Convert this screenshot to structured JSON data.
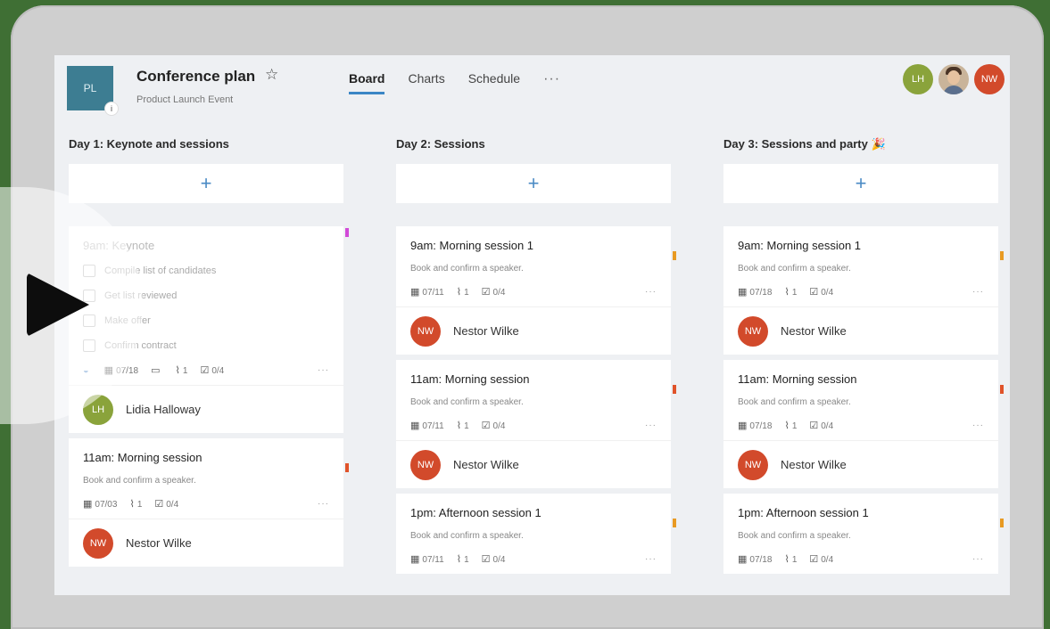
{
  "header": {
    "tile_initials": "PL",
    "tile_badge": "i",
    "title": "Conference plan",
    "subtitle": "Product Launch Event",
    "tabs": [
      {
        "label": "Board",
        "active": true
      },
      {
        "label": "Charts",
        "active": false
      },
      {
        "label": "Schedule",
        "active": false
      }
    ],
    "more": "···",
    "members": [
      "LH",
      "",
      "NW"
    ]
  },
  "columns": [
    {
      "title": "Day 1: Keynote and sessions",
      "add": "+",
      "cards": [
        {
          "title": "9am: Keynote",
          "checklist": [
            "Compile list of candidates",
            "Get list reviewed",
            "Make offer",
            "Confirm contract"
          ],
          "date": "07/18",
          "attachments": "1",
          "checks": "0/4",
          "assignee_initials": "LH",
          "assignee": "Lidia Halloway"
        },
        {
          "title": "11am: Morning session",
          "desc": "Book and confirm a speaker.",
          "date": "07/03",
          "attachments": "1",
          "checks": "0/4",
          "assignee_initials": "NW",
          "assignee": "Nestor Wilke"
        }
      ]
    },
    {
      "title": "Day 2: Sessions",
      "add": "+",
      "cards": [
        {
          "title": "9am: Morning session 1",
          "desc": "Book and confirm a speaker.",
          "date": "07/11",
          "attachments": "1",
          "checks": "0/4",
          "assignee_initials": "NW",
          "assignee": "Nestor Wilke"
        },
        {
          "title": "11am: Morning session",
          "desc": "Book and confirm a speaker.",
          "date": "07/11",
          "attachments": "1",
          "checks": "0/4",
          "assignee_initials": "NW",
          "assignee": "Nestor Wilke"
        },
        {
          "title": "1pm: Afternoon session 1",
          "desc": "Book and confirm a speaker.",
          "date": "07/11",
          "attachments": "1",
          "checks": "0/4"
        }
      ]
    },
    {
      "title": "Day 3: Sessions and party 🎉",
      "add": "+",
      "cards": [
        {
          "title": "9am: Morning session 1",
          "desc": "Book and confirm a speaker.",
          "date": "07/18",
          "attachments": "1",
          "checks": "0/4",
          "assignee_initials": "NW",
          "assignee": "Nestor Wilke"
        },
        {
          "title": "11am: Morning session",
          "desc": "Book and confirm a speaker.",
          "date": "07/18",
          "attachments": "1",
          "checks": "0/4",
          "assignee_initials": "NW",
          "assignee": "Nestor Wilke"
        },
        {
          "title": "1pm: Afternoon session 1",
          "desc": "Book and confirm a speaker.",
          "date": "07/18",
          "attachments": "1",
          "checks": "0/4"
        }
      ]
    }
  ],
  "colors": {
    "accent": "#3b86c5",
    "tile": "#3d7d92",
    "avatar_lh": "#8aa33b",
    "avatar_nw": "#d24a2b",
    "flag_orange": "#e89a23",
    "flag_red": "#e0532a"
  },
  "icons": {
    "date": "calendar-icon",
    "attachments": "paperclip-icon",
    "checks": "checklist-icon",
    "comments": "comment-icon",
    "favorite": "star-icon",
    "play": "play-icon"
  }
}
